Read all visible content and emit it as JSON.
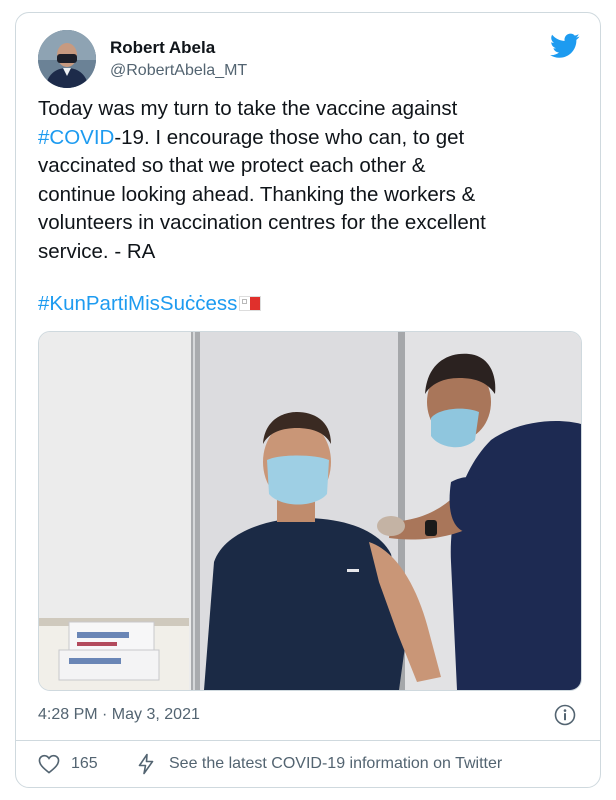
{
  "author": {
    "name": "Robert Abela",
    "handle": "@RobertAbela_MT"
  },
  "tweet": {
    "text_line1": "Today was my turn to take the vaccine against",
    "hashtag_covid": "#COVID",
    "text_line2_rest": "-19. I encourage those who can, to get",
    "text_line3": "vaccinated so that we protect each other &",
    "text_line4": "continue looking ahead. Thanking the workers &",
    "text_line5": "volunteers in vaccination centres for the excellent",
    "text_line6": "service. - RA",
    "hashtag_campaign": "#KunPartiMisSuċċess"
  },
  "photo": {
    "shirt_brand": "BOSS"
  },
  "meta": {
    "timestamp": "4:28 PM · May 3, 2021"
  },
  "footer": {
    "likes": "165",
    "covid_info": "See the latest COVID-19 information on Twitter"
  },
  "colors": {
    "accent": "#1d9bf0",
    "text": "#0f1419",
    "muted": "#536471",
    "border": "#cfd9de"
  },
  "icons": [
    "twitter-bird-icon",
    "malta-flag-icon",
    "info-icon",
    "heart-icon",
    "lightning-icon"
  ]
}
